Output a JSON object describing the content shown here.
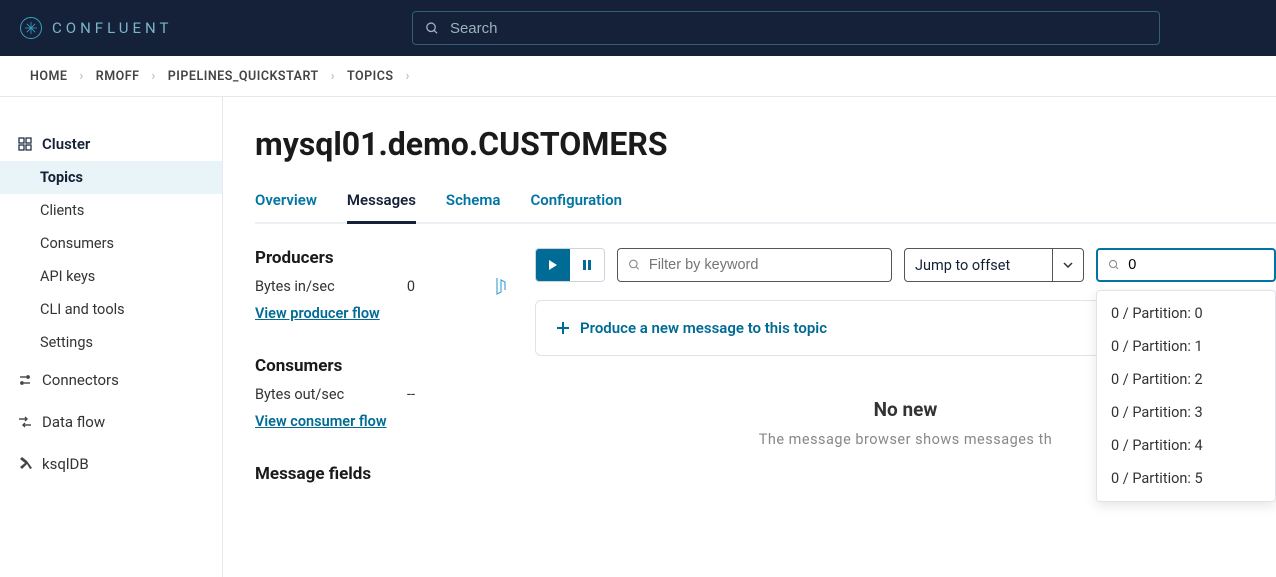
{
  "header": {
    "brand": "CONFLUENT",
    "search_placeholder": "Search"
  },
  "breadcrumbs": [
    "HOME",
    "RMOFF",
    "PIPELINES_QUICKSTART",
    "TOPICS"
  ],
  "sidebar": {
    "cluster": "Cluster",
    "subs": [
      "Topics",
      "Clients",
      "Consumers",
      "API keys",
      "CLI and tools",
      "Settings"
    ],
    "items": [
      "Connectors",
      "Data flow",
      "ksqlDB"
    ]
  },
  "page": {
    "title": "mysql01.demo.CUSTOMERS"
  },
  "tabs": [
    "Overview",
    "Messages",
    "Schema",
    "Configuration"
  ],
  "producers": {
    "heading": "Producers",
    "metric_label": "Bytes in/sec",
    "metric_value": "0",
    "link": "View producer flow"
  },
  "consumers": {
    "heading": "Consumers",
    "metric_label": "Bytes out/sec",
    "metric_value": "--",
    "link": "View consumer flow"
  },
  "message_fields": "Message fields",
  "controls": {
    "filter_placeholder": "Filter by keyword",
    "jump_label": "Jump to offset",
    "offset_value": "0"
  },
  "produce_cta": "Produce a new message to this topic",
  "no_messages": {
    "title": "No new",
    "subtitle": "The message browser shows messages th"
  },
  "partitions": [
    "0 / Partition: 0",
    "0 / Partition: 1",
    "0 / Partition: 2",
    "0 / Partition: 3",
    "0 / Partition: 4",
    "0 / Partition: 5"
  ]
}
